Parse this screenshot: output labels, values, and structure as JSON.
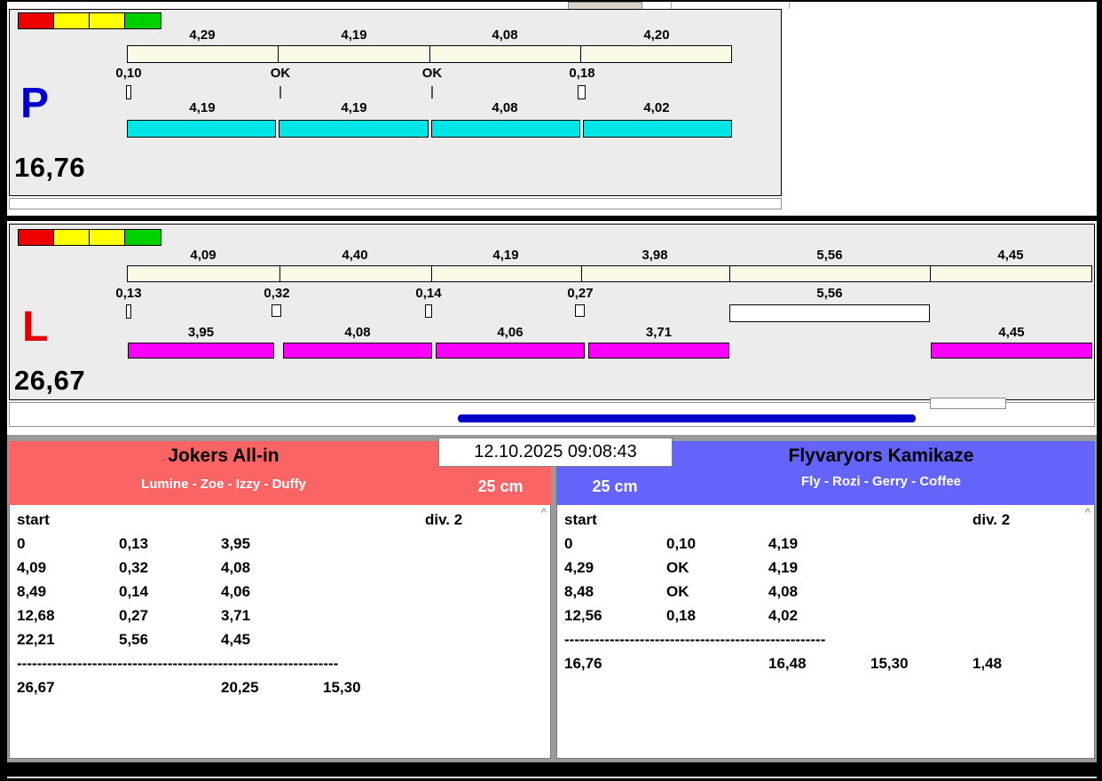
{
  "colors": {
    "background_panel": "#ececec",
    "top_bar_fill": "#fbfae6",
    "lane_p_bar_fill": "#00e5e5",
    "lane_l_bar_fill": "#fa00fa",
    "lane_p_letter": "#0000cd",
    "lane_l_letter": "#e00000",
    "progress_bar": "#0000c8",
    "team_left_header": "#fa6464",
    "team_right_header": "#6464fa",
    "status_lights": [
      "#ee0000",
      "#ffff00",
      "#ffff00",
      "#00d000"
    ]
  },
  "icons": {
    "scroll_up": "^"
  },
  "datetime": "12.10.2025 09:08:43",
  "lane_p": {
    "letter": "P",
    "total": "16,76",
    "upper_values": [
      "4,29",
      "4,19",
      "4,08",
      "4,20"
    ],
    "checkpoint_labels": [
      "0,10",
      "OK",
      "OK",
      "0,18"
    ],
    "lower_values": [
      "4,19",
      "4,19",
      "4,08",
      "4,02"
    ]
  },
  "lane_l": {
    "letter": "L",
    "total": "26,67",
    "upper_values": [
      "4,09",
      "4,40",
      "4,19",
      "3,98",
      "5,56",
      "4,45"
    ],
    "checkpoint_labels": [
      "0,13",
      "0,32",
      "0,14",
      "0,27",
      "5,56"
    ],
    "lower_values": [
      "3,95",
      "4,08",
      "4,06",
      "3,71",
      "4,45"
    ]
  },
  "team_left": {
    "name": "Jokers All-in",
    "players": "Lumine - Zoe - Izzy - Duffy",
    "distance": "25 cm",
    "start_label": "start",
    "division": "div. 2",
    "rows": [
      [
        "0",
        "0,13",
        "3,95"
      ],
      [
        "4,09",
        "0,32",
        "4,08"
      ],
      [
        "8,49",
        "0,14",
        "4,06"
      ],
      [
        "12,68",
        "0,27",
        "3,71"
      ],
      [
        "22,21",
        "5,56",
        "4,45"
      ]
    ],
    "separator": "----------------------------------------------------------------",
    "totals": [
      "26,67",
      "20,25",
      "15,30"
    ]
  },
  "team_right": {
    "name": "Flyvaryors Kamikaze",
    "players": "Fly - Rozi - Gerry - Coffee",
    "distance": "25 cm",
    "start_label": "start",
    "division": "div. 2",
    "rows": [
      [
        "0",
        "0,10",
        "4,19"
      ],
      [
        "4,29",
        "OK",
        "4,19"
      ],
      [
        "8,48",
        "OK",
        "4,08"
      ],
      [
        "12,56",
        "0,18",
        "4,02"
      ]
    ],
    "separator": "----------------------------------------------------",
    "totals": [
      "16,76",
      "16,48",
      "15,30",
      "1,48"
    ]
  }
}
